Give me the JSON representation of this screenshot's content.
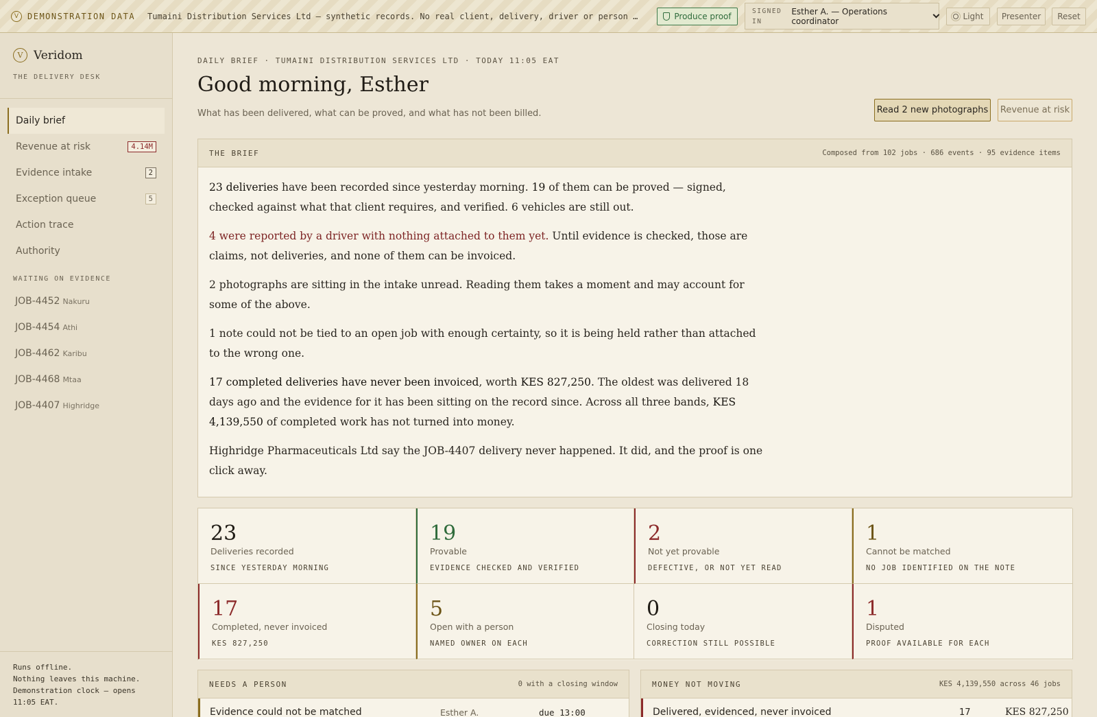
{
  "banner": {
    "label": "DEMONSTRATION DATA",
    "text": "Tumaini Distribution Services Ltd — synthetic records. No real client, delivery, driver or person is represented.",
    "proof_button": "Produce proof",
    "signed_in_label": "SIGNED IN",
    "user": "Esther A. — Operations coordinator",
    "light_button": "Light",
    "presenter_button": "Presenter",
    "reset_button": "Reset"
  },
  "sidebar": {
    "brand": "Veridom",
    "brand_initial": "V",
    "subtitle": "THE DELIVERY DESK",
    "nav": [
      {
        "label": "Daily brief",
        "badge": null
      },
      {
        "label": "Revenue at risk",
        "badge": "4.14M"
      },
      {
        "label": "Evidence intake",
        "badge": "2"
      },
      {
        "label": "Exception queue",
        "badge": "5"
      },
      {
        "label": "Action trace",
        "badge": null
      },
      {
        "label": "Authority",
        "badge": null
      }
    ],
    "section_label": "WAITING ON EVIDENCE",
    "jobs": [
      {
        "id": "JOB-4452",
        "loc": "Nakuru"
      },
      {
        "id": "JOB-4454",
        "loc": "Athi"
      },
      {
        "id": "JOB-4462",
        "loc": "Karibu"
      },
      {
        "id": "JOB-4468",
        "loc": "Mtaa"
      },
      {
        "id": "JOB-4407",
        "loc": "Highridge"
      }
    ],
    "footer": [
      "Runs offline.",
      "Nothing leaves this machine.",
      "Demonstration clock — opens",
      "11:05 EAT."
    ]
  },
  "main": {
    "eyebrow": "DAILY BRIEF · TUMAINI DISTRIBUTION SERVICES LTD · TODAY 11:05 EAT",
    "title": "Good morning, Esther",
    "subtitle": "What has been delivered, what can be proved, and what has not been billed.",
    "primary_button": "Read 2 new photographs",
    "secondary_button": "Revenue at risk"
  },
  "brief": {
    "title": "THE BRIEF",
    "meta": "Composed from 102 jobs · 686 events · 95 evidence items",
    "p1_a": "23 deliveries",
    "p1_b": " have been recorded since yesterday morning. ",
    "p1_c": "19",
    "p1_d": " of them can be proved — signed, checked against what that client requires, and verified. 6 vehicles are still out.",
    "p2_a": "4 were reported by a driver with nothing attached to them yet.",
    "p2_b": " Until evidence is checked, those are claims, not deliveries, and none of them can be invoiced.",
    "p3": "2 photographs are sitting in the intake unread. Reading them takes a moment and may account for some of the above.",
    "p4": "1 note could not be tied to an open job with enough certainty, so it is being held rather than attached to the wrong one.",
    "p5_a": "17 completed deliveries have never been invoiced",
    "p5_b": ", worth ",
    "p5_c": "KES 827,250",
    "p5_d": ". The oldest was delivered 18 days ago and the evidence for it has been sitting on the record since. Across all three bands, ",
    "p5_e": "KES 4,139,550",
    "p5_f": " of completed work has not turned into money.",
    "p6": "Highridge Pharmaceuticals Ltd say the JOB-4407 delivery never happened. It did, and the proof is one click away."
  },
  "stats": [
    {
      "num": "23",
      "label": "Deliveries recorded",
      "sub": "SINCE YESTERDAY MORNING",
      "tone": "none"
    },
    {
      "num": "19",
      "label": "Provable",
      "sub": "EVIDENCE CHECKED AND VERIFIED",
      "tone": "green"
    },
    {
      "num": "2",
      "label": "Not yet provable",
      "sub": "DEFECTIVE, OR NOT YET READ",
      "tone": "red"
    },
    {
      "num": "1",
      "label": "Cannot be matched",
      "sub": "NO JOB IDENTIFIED ON THE NOTE",
      "tone": "amber"
    },
    {
      "num": "17",
      "label": "Completed, never invoiced",
      "sub": "KES 827,250",
      "tone": "red"
    },
    {
      "num": "5",
      "label": "Open with a person",
      "sub": "NAMED OWNER ON EACH",
      "tone": "amber"
    },
    {
      "num": "0",
      "label": "Closing today",
      "sub": "CORRECTION STILL POSSIBLE",
      "tone": "none"
    },
    {
      "num": "1",
      "label": "Disputed",
      "sub": "PROOF AVAILABLE FOR EACH",
      "tone": "red"
    }
  ],
  "needs_person": {
    "title": "NEEDS A PERSON",
    "meta": "0 with a closing window",
    "row_label": "Evidence could not be matched",
    "row_owner": "Esther A.",
    "row_due": "due 13:00"
  },
  "money": {
    "title": "MONEY NOT MOVING",
    "meta": "KES 4,139,550 across 46 jobs",
    "row_label": "Delivered, evidenced, never invoiced",
    "row_count": "17",
    "row_amount": "KES 827,250"
  },
  "colors": {
    "accent": "#8a6d1f",
    "green": "#2f6b3b",
    "red": "#8c2a2a",
    "background": "#ede6d6",
    "card": "#f7f3e8"
  }
}
